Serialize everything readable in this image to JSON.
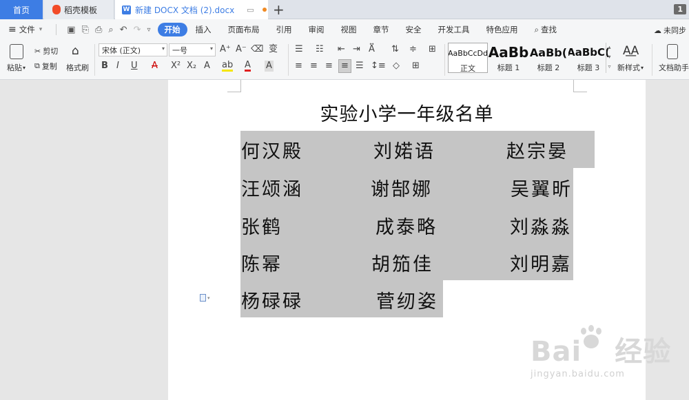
{
  "tabs": {
    "home": "首页",
    "template": "稻壳模板",
    "document": "新建 DOCX 文档 (2).docx",
    "add": "+",
    "page_number": "1"
  },
  "menubar": {
    "file": "文件",
    "items": [
      "开始",
      "插入",
      "页面布局",
      "引用",
      "审阅",
      "视图",
      "章节",
      "安全",
      "开发工具",
      "特色应用"
    ],
    "active": "开始",
    "search": "查找",
    "sync": "未同步"
  },
  "ribbon": {
    "paste": "粘贴",
    "cut": "剪切",
    "copy": "复制",
    "format_painter": "格式刷",
    "font_name": "宋体 (正文)",
    "font_size": "一号",
    "styles": [
      {
        "sample": "AaBbCcDd",
        "name": "正文"
      },
      {
        "sample": "AaBb",
        "name": "标题 1"
      },
      {
        "sample": "AaBb(",
        "name": "标题 2"
      },
      {
        "sample": "AaBbC(",
        "name": "标题 3"
      }
    ],
    "new_style": "新样式",
    "doc_helper": "文档助手"
  },
  "document": {
    "title": "实验小学一年级名单",
    "rows": [
      [
        "何汉殿",
        "刘婼语",
        "赵宗晏"
      ],
      [
        "汪颂涵",
        "谢郜娜",
        "吴翼昕"
      ],
      [
        "张鹤",
        "成泰略",
        "刘淼淼"
      ],
      [
        "陈幂",
        "胡笳佳",
        "刘明嘉"
      ],
      [
        "杨碌碌",
        "菅纫姿"
      ]
    ]
  },
  "watermark": {
    "brand": "Bai",
    "brand2": "经验",
    "url": "jingyan.baidu.com"
  }
}
